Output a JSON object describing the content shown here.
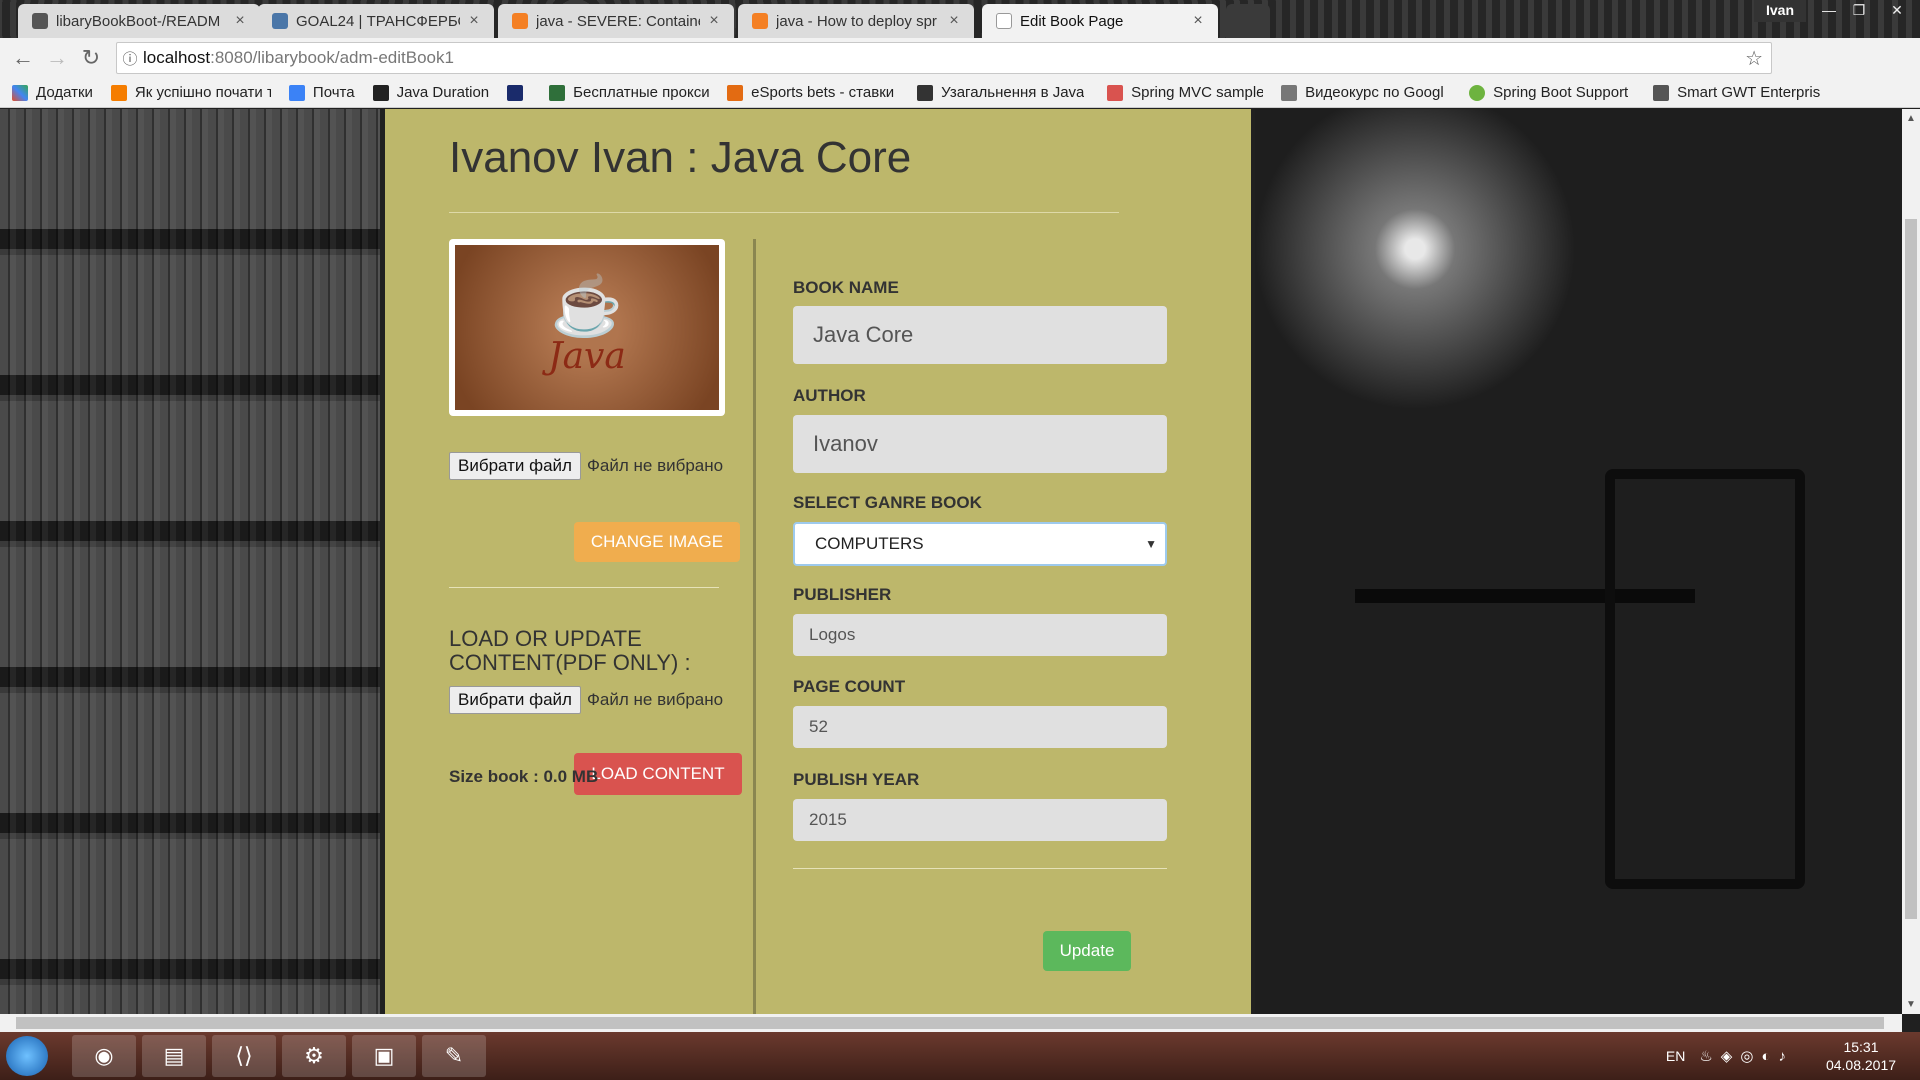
{
  "browser": {
    "user": "Ivan",
    "tabs": [
      {
        "title": "libaryBookBoot-/READM",
        "fav_color": "#555555"
      },
      {
        "title": "GOAL24 | ТРАНСФЕРБО",
        "fav_color": "#4a76a8"
      },
      {
        "title": "java - SEVERE: Container",
        "fav_color": "#f48024"
      },
      {
        "title": "java - How to deploy spr",
        "fav_color": "#f48024"
      },
      {
        "title": "Edit Book Page",
        "fav_color": "#ffffff"
      }
    ],
    "url_host": "localhost",
    "url_path": ":8080/libarybook/adm-editBook1",
    "bookmarks": [
      {
        "label": "Додатки",
        "color": "#e44d26"
      },
      {
        "label": "Як успішно почати т",
        "color": "#f57d00"
      },
      {
        "label": "Почта",
        "color": "#3b82f6"
      },
      {
        "label": "Java Duration",
        "color": "#222222"
      },
      {
        "label": "",
        "color": "#1a2b6b"
      },
      {
        "label": "Бесплатные прокси",
        "color": "#2f6f3a"
      },
      {
        "label": "eSports bets - ставки",
        "color": "#e36b12"
      },
      {
        "label": "Узагальнення в Java",
        "color": "#333333"
      },
      {
        "label": "Spring MVC sample",
        "color": "#d9534f"
      },
      {
        "label": "Видеокурс по Googl",
        "color": "#777777"
      },
      {
        "label": "Spring Boot Support",
        "color": "#6db33f"
      },
      {
        "label": "Smart GWT Enterpris",
        "color": "#555555"
      }
    ]
  },
  "page": {
    "title": "Ivanov Ivan : Java Core",
    "image_word": "Java",
    "file_button": "Вибрати файл",
    "file_none": "Файл не вибрано",
    "change_image": "CHANGE IMAGE",
    "load_label": "LOAD OR UPDATE CONTENT(PDF ONLY) :",
    "load_content": "LOAD CONTENT",
    "size_book": "Size book : 0.0 MB",
    "labels": {
      "book_name": "BOOK NAME",
      "author": "AUTHOR",
      "genre": "SELECT GANRE BOOK",
      "publisher": "PUBLISHER",
      "page_count": "PAGE COUNT",
      "publish_year": "PUBLISH YEAR"
    },
    "values": {
      "book_name": "Java Core",
      "author": "Ivanov",
      "genre": "COMPUTERS",
      "publisher": "Logos",
      "page_count": "52",
      "publish_year": "2015"
    },
    "update": "Update"
  },
  "taskbar": {
    "lang": "EN",
    "time": "15:31",
    "date": "04.08.2017"
  }
}
